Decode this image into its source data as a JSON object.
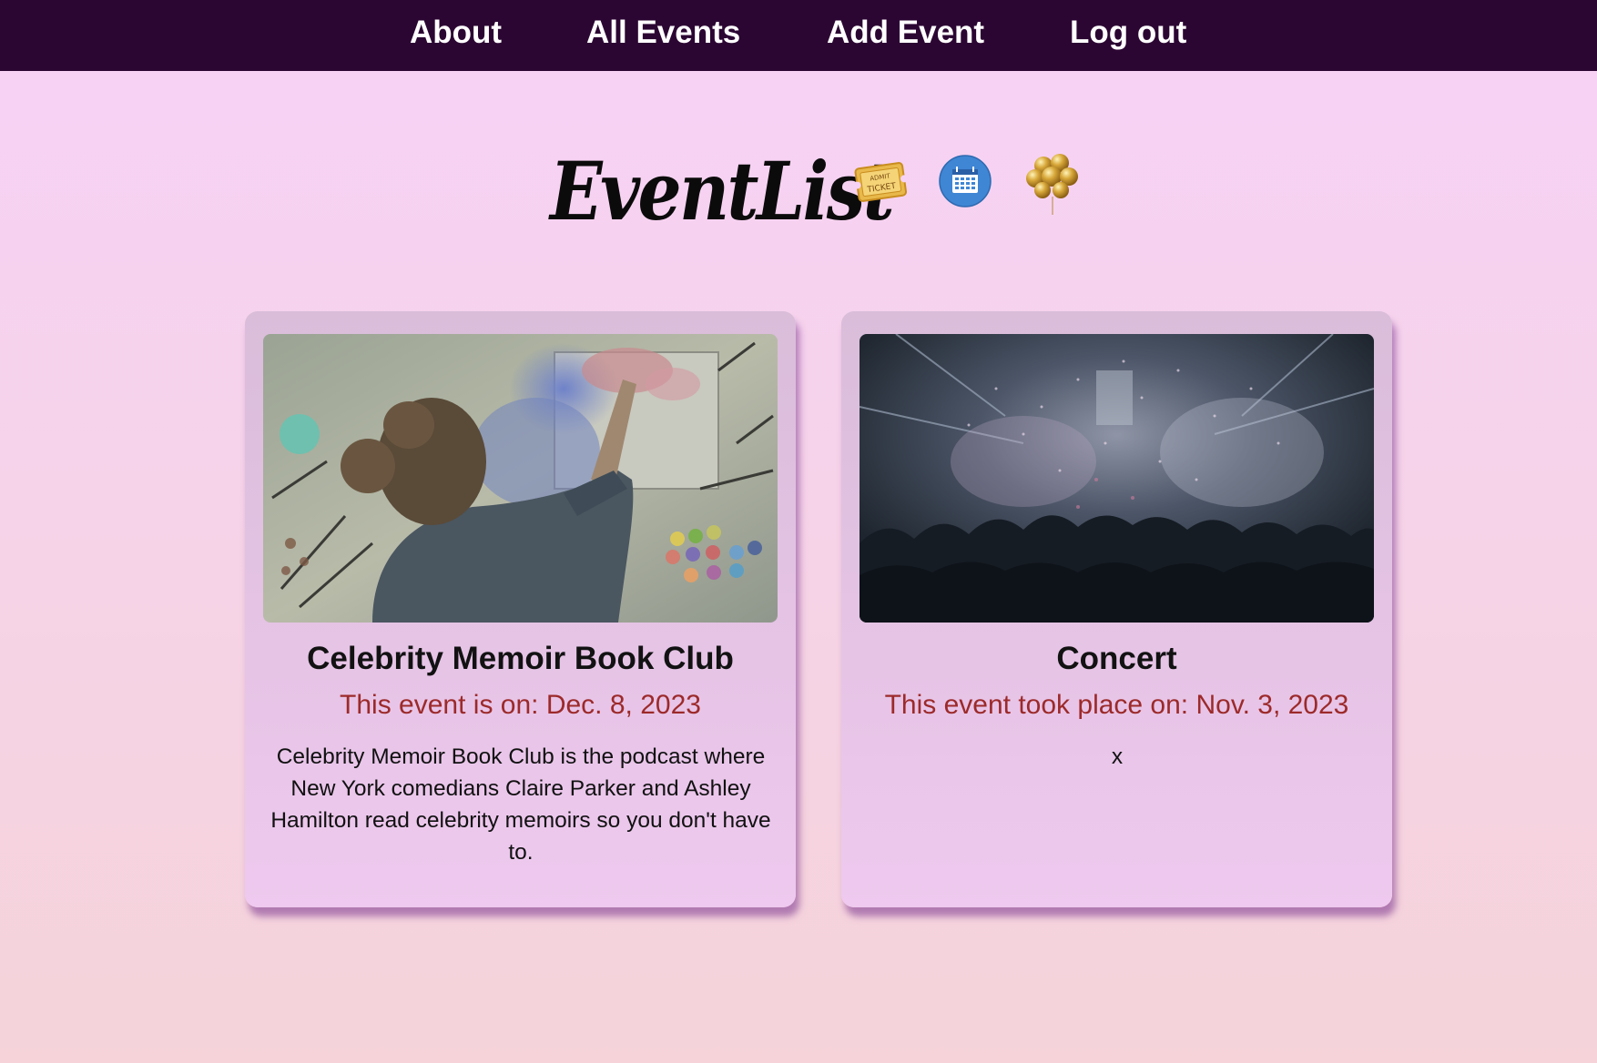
{
  "nav": {
    "items": [
      {
        "label": "About"
      },
      {
        "label": "All Events"
      },
      {
        "label": "Add Event"
      },
      {
        "label": "Log out"
      }
    ]
  },
  "header": {
    "title": "EventList",
    "icons": [
      "ticket-icon",
      "calendar-icon",
      "balloons-icon"
    ],
    "ticket_text_top": "ADMIT",
    "ticket_text_bottom": "TICKET"
  },
  "events": [
    {
      "title": "Celebrity Memoir Book Club",
      "date_text": "This event is on: Dec. 8, 2023",
      "description": "Celebrity Memoir Book Club is the podcast where New York comedians Claire Parker and Ashley Hamilton read celebrity memoirs so you don't have to.",
      "image": "painting-artist-photo"
    },
    {
      "title": "Concert",
      "date_text": "This event took place on: Nov. 3, 2023",
      "description": "x",
      "image": "concert-crowd-photo"
    }
  ],
  "colors": {
    "navbar_bg": "#2c0633",
    "date_text": "#9c2a2a",
    "page_bg_top": "#f7d2f7",
    "page_bg_bottom": "#f5d3d9"
  }
}
